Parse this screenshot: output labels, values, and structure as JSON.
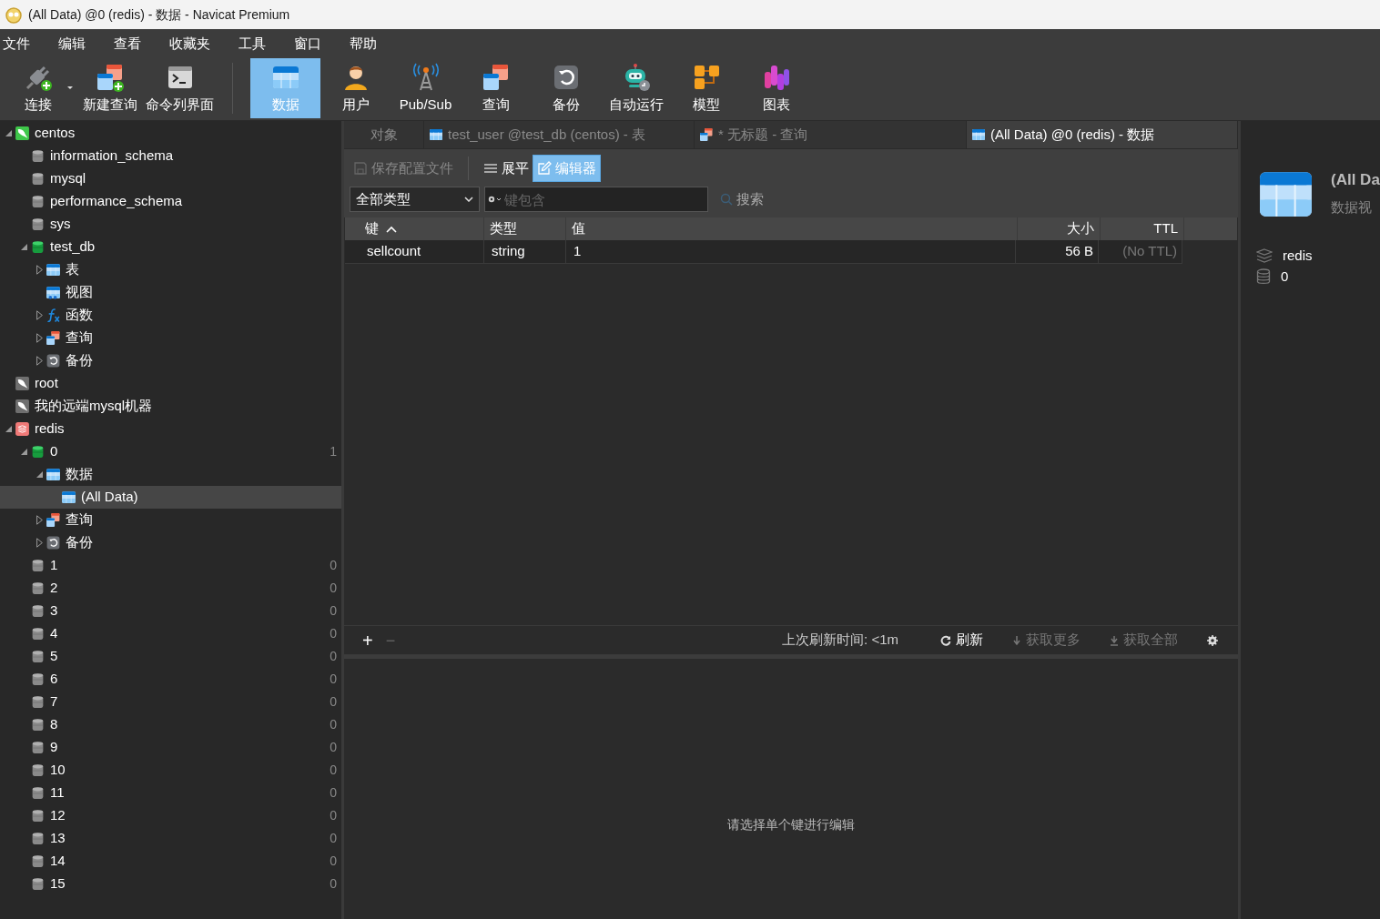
{
  "window": {
    "title": "(All Data) @0 (redis) - 数据 - Navicat Premium"
  },
  "menu": [
    "文件",
    "编辑",
    "查看",
    "收藏夹",
    "工具",
    "窗口",
    "帮助"
  ],
  "toolbar_left": [
    {
      "label": "连接",
      "kind": "plug",
      "dropdown": true,
      "selected": false
    },
    {
      "label": "新建查询",
      "kind": "newquery",
      "dropdown": false,
      "selected": false
    },
    {
      "label": "命令列界面",
      "kind": "terminal",
      "dropdown": false,
      "selected": false
    }
  ],
  "toolbar_right": [
    {
      "label": "数据",
      "kind": "table",
      "selected": true
    },
    {
      "label": "用户",
      "kind": "user",
      "selected": false
    },
    {
      "label": "Pub/Sub",
      "kind": "antenna",
      "selected": false
    },
    {
      "label": "查询",
      "kind": "query",
      "selected": false
    },
    {
      "label": "备份",
      "kind": "backup",
      "selected": false
    },
    {
      "label": "自动运行",
      "kind": "robot",
      "selected": false
    },
    {
      "label": "模型",
      "kind": "model",
      "selected": false
    },
    {
      "label": "图表",
      "kind": "chart",
      "selected": false
    }
  ],
  "tree": [
    {
      "label": "centos",
      "kind": "mysql",
      "expanded": true,
      "selected": false,
      "children": [
        {
          "label": "information_schema",
          "kind": "db",
          "selected": false
        },
        {
          "label": "mysql",
          "kind": "db",
          "selected": false
        },
        {
          "label": "performance_schema",
          "kind": "db",
          "selected": false
        },
        {
          "label": "sys",
          "kind": "db",
          "selected": false
        },
        {
          "label": "test_db",
          "kind": "dbopen",
          "expanded": true,
          "selected": false,
          "children": [
            {
              "label": "表",
              "kind": "table",
              "expanded": false,
              "selected": false
            },
            {
              "label": "视图",
              "kind": "view",
              "selected": false
            },
            {
              "label": "函数",
              "kind": "function",
              "expanded": false,
              "selected": false
            },
            {
              "label": "查询",
              "kind": "query",
              "expanded": false,
              "selected": false
            },
            {
              "label": "备份",
              "kind": "backup",
              "expanded": false,
              "selected": false
            }
          ]
        }
      ]
    },
    {
      "label": "root",
      "kind": "mysqloff",
      "selected": false
    },
    {
      "label": "我的远端mysql机器",
      "kind": "mysqloff",
      "selected": false
    },
    {
      "label": "redis",
      "kind": "redis",
      "expanded": true,
      "selected": false,
      "children": [
        {
          "label": "0",
          "kind": "dbopen",
          "count": "1",
          "expanded": true,
          "selected": false,
          "children": [
            {
              "label": "数据",
              "kind": "table",
              "expanded": true,
              "selected": false,
              "children": [
                {
                  "label": "(All Data)",
                  "kind": "table",
                  "selected": true
                }
              ]
            },
            {
              "label": "查询",
              "kind": "query",
              "expanded": false,
              "selected": false
            },
            {
              "label": "备份",
              "kind": "backup",
              "expanded": false,
              "selected": false
            }
          ]
        },
        {
          "label": "1",
          "kind": "db",
          "count": "0",
          "selected": false
        },
        {
          "label": "2",
          "kind": "db",
          "count": "0",
          "selected": false
        },
        {
          "label": "3",
          "kind": "db",
          "count": "0",
          "selected": false
        },
        {
          "label": "4",
          "kind": "db",
          "count": "0",
          "selected": false
        },
        {
          "label": "5",
          "kind": "db",
          "count": "0",
          "selected": false
        },
        {
          "label": "6",
          "kind": "db",
          "count": "0",
          "selected": false
        },
        {
          "label": "7",
          "kind": "db",
          "count": "0",
          "selected": false
        },
        {
          "label": "8",
          "kind": "db",
          "count": "0",
          "selected": false
        },
        {
          "label": "9",
          "kind": "db",
          "count": "0",
          "selected": false
        },
        {
          "label": "10",
          "kind": "db",
          "count": "0",
          "selected": false
        },
        {
          "label": "11",
          "kind": "db",
          "count": "0",
          "selected": false
        },
        {
          "label": "12",
          "kind": "db",
          "count": "0",
          "selected": false
        },
        {
          "label": "13",
          "kind": "db",
          "count": "0",
          "selected": false
        },
        {
          "label": "14",
          "kind": "db",
          "count": "0",
          "selected": false
        },
        {
          "label": "15",
          "kind": "db",
          "count": "0",
          "selected": false
        }
      ]
    }
  ],
  "tabs": [
    {
      "label": "对象",
      "kind": "plain",
      "selected": false
    },
    {
      "label": "test_user @test_db (centos) - 表",
      "kind": "table",
      "selected": false
    },
    {
      "label": "* 无标题 - 查询",
      "kind": "query",
      "selected": false
    },
    {
      "label": "(All Data) @0 (redis) - 数据",
      "kind": "table",
      "selected": true
    }
  ],
  "tab_toolbar": [
    {
      "label": "保存配置文件",
      "kind": "save",
      "disabled": true,
      "selected": false
    },
    {
      "label": "展平",
      "kind": "list",
      "disabled": false,
      "selected": false
    },
    {
      "label": "编辑器",
      "kind": "edit",
      "disabled": false,
      "selected": true
    }
  ],
  "filter": {
    "type_select": "全部类型",
    "placeholder": "键包含",
    "search": "搜索"
  },
  "table": {
    "columns": [
      {
        "label": "键",
        "sort_ascending": true
      },
      {
        "label": "类型"
      },
      {
        "label": "值"
      },
      {
        "label": "大小"
      },
      {
        "label": "TTL"
      }
    ],
    "rows": [
      {
        "cells": [
          "sellcount",
          "string",
          "1",
          "56 B",
          "(No TTL)"
        ],
        "selected": false
      }
    ]
  },
  "footer": {
    "add": "+",
    "remove": "−",
    "refresh_time": "上次刷新时间: <1m",
    "actions": [
      {
        "label": "刷新",
        "kind": "refresh",
        "disabled": false
      },
      {
        "label": "获取更多",
        "kind": "more",
        "disabled": true
      },
      {
        "label": "获取全部",
        "kind": "all",
        "disabled": true
      }
    ]
  },
  "editor": {
    "message": "请选择单个键进行编辑"
  },
  "info": {
    "title": "(All Da",
    "subtitle": "数据视",
    "items": [
      {
        "kind": "server",
        "text": "redis"
      },
      {
        "kind": "database",
        "text": "0"
      }
    ]
  }
}
